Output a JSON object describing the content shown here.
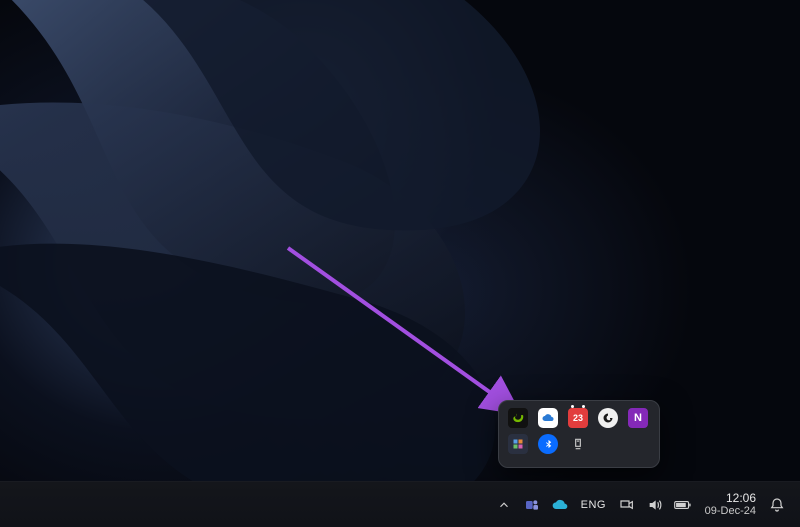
{
  "taskbar": {
    "language": "ENG",
    "clock": {
      "time": "12:06",
      "date": "09-Dec-24"
    }
  },
  "tray_flyout": {
    "items": [
      {
        "name": "nvidia",
        "badge": ""
      },
      {
        "name": "cloud-app",
        "badge": ""
      },
      {
        "name": "calendar-app",
        "badge": "23"
      },
      {
        "name": "logitech-g",
        "badge": ""
      },
      {
        "name": "onenote",
        "badge": "N"
      },
      {
        "name": "app-generic",
        "badge": ""
      },
      {
        "name": "bluetooth",
        "badge": ""
      },
      {
        "name": "safely-remove",
        "badge": ""
      }
    ]
  },
  "annotation": {
    "arrow_color": "#a24fe0"
  },
  "colors": {
    "flyout_bg": "#24262c",
    "taskbar_bg": "#14161b",
    "nvidia_green": "#76b900",
    "bluetooth_blue": "#0a6cff",
    "onenote_purple": "#8429b8",
    "calendar_red": "#e23d3d",
    "logitech_bg": "#f0f0f0"
  }
}
